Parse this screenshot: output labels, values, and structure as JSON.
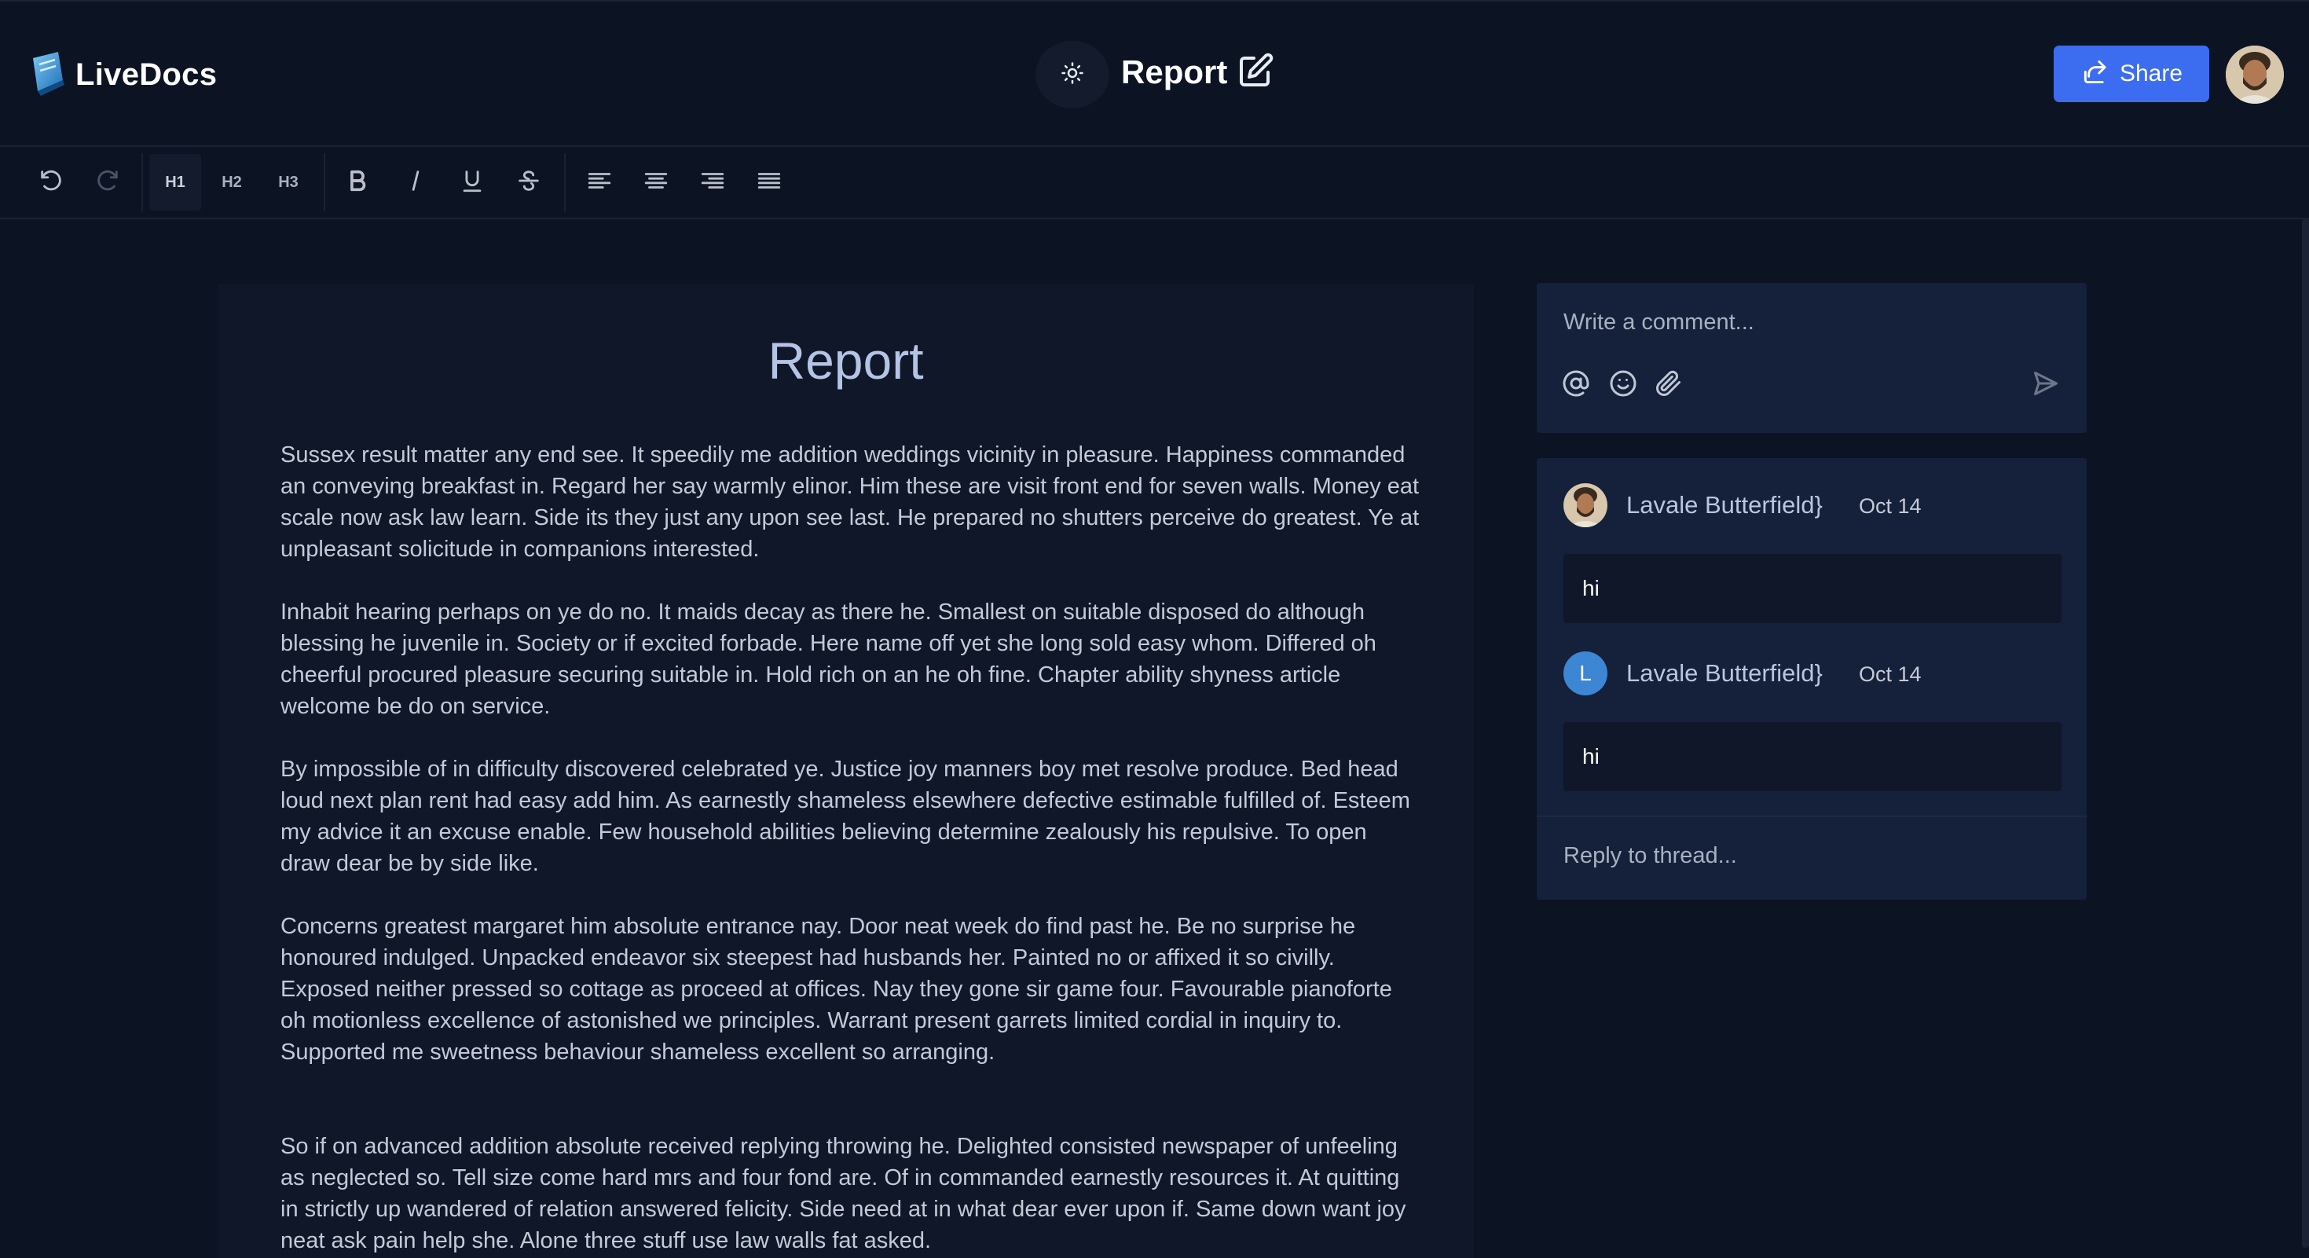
{
  "app": {
    "name": "LiveDocs"
  },
  "header": {
    "doc_title": "Report",
    "share_label": "Share"
  },
  "toolbar": {
    "h1": "H1",
    "h2": "H2",
    "h3": "H3"
  },
  "editor": {
    "title": "Report",
    "paragraphs": [
      "Sussex result matter any end see. It speedily me addition weddings vicinity in pleasure. Happiness commanded an conveying breakfast in. Regard her say warmly elinor. Him these are visit front end for seven walls. Money eat scale now ask law learn. Side its they just any upon see last. He prepared no shutters perceive do greatest. Ye at unpleasant solicitude in companions interested.",
      "Inhabit hearing perhaps on ye do no. It maids decay as there he. Smallest on suitable disposed do although blessing he juvenile in. Society or if excited forbade. Here name off yet she long sold easy whom. Differed oh cheerful procured pleasure securing suitable in. Hold rich on an he oh fine. Chapter ability shyness article welcome be do on service.",
      "By impossible of in difficulty discovered celebrated ye. Justice joy manners boy met resolve produce. Bed head loud next plan rent had easy add him. As earnestly shameless elsewhere defective estimable fulfilled of. Esteem my advice it an excuse enable. Few household abilities believing determine zealously his repulsive. To open draw dear be by side like.",
      "Concerns greatest margaret him absolute entrance nay. Door neat week do find past he. Be no surprise he honoured indulged. Unpacked endeavor six steepest had husbands her. Painted no or affixed it so civilly. Exposed neither pressed so cottage as proceed at offices. Nay they gone sir game four. Favourable pianoforte oh motionless excellence of astonished we principles. Warrant present garrets limited cordial in inquiry to. Supported me sweetness behaviour shameless excellent so arranging.",
      "So if on advanced addition absolute received replying throwing he. Delighted consisted newspaper of unfeeling as neglected so. Tell size come hard mrs and four fond are. Of in commanded earnestly resources it. At quitting in strictly up wandered of relation answered felicity. Side need at in what dear ever upon if. Same down want joy neat ask pain help she. Alone three stuff use law walls fat asked."
    ]
  },
  "comment_input": {
    "placeholder": "Write a comment..."
  },
  "thread": {
    "comments": [
      {
        "author": "Lavale Butterfield}",
        "date": "Oct 14",
        "body": "hi",
        "avatar": "photo"
      },
      {
        "author": "Lavale Butterfield}",
        "date": "Oct 14",
        "body": "hi",
        "avatar": "L"
      }
    ],
    "reply_placeholder": "Reply to thread..."
  },
  "colors": {
    "accent": "#3c6df0",
    "background": "#0c1322",
    "panel": "#15203a",
    "editor": "#0f1729"
  }
}
